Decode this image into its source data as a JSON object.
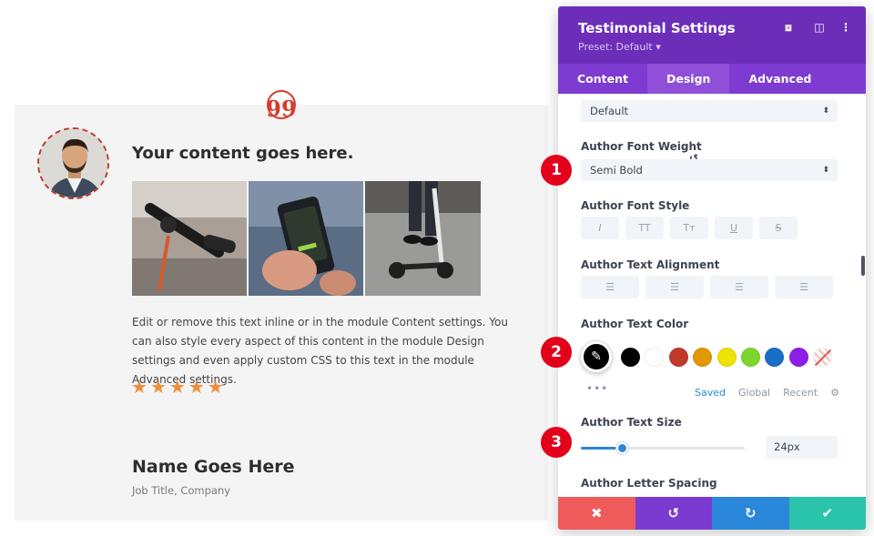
{
  "module": {
    "quote_glyph": "99",
    "content_title": "Your content goes here.",
    "body_text": "Edit or remove this text inline or in the module Content settings. You can also style every aspect of this content in the module Design settings and even apply custom CSS to this text in the module Advanced settings.",
    "rating": 5,
    "star_glyph": "★",
    "author_name": "Name Goes Here",
    "author_meta": "Job Title, Company"
  },
  "panel": {
    "title": "Testimonial Settings",
    "preset": "Preset: Default ▾",
    "tabs": [
      "Content",
      "Design",
      "Advanced"
    ],
    "active_tab": "Design",
    "font_select_value": "Default",
    "weight_label": "Author Font Weight",
    "weight_value": "Semi Bold",
    "style_label": "Author Font Style",
    "style_buttons": [
      "I",
      "TT",
      "Tт",
      "U",
      "S"
    ],
    "align_label": "Author Text Alignment",
    "color_label": "Author Text Color",
    "swatch_colors": [
      "#000000",
      "#ffffff",
      "#c0392b",
      "#e09900",
      "#ede200",
      "#7cd62d",
      "#1a6fc4",
      "#8c1ee5"
    ],
    "color_tabs": [
      "Saved",
      "Global",
      "Recent"
    ],
    "more_dots": "•••",
    "size_label": "Author Text Size",
    "size_value": "24px",
    "size_fraction": 0.25,
    "spacing_label": "Author Letter Spacing"
  },
  "markers": [
    "1",
    "2",
    "3"
  ],
  "colors": {
    "header": "#6c2eb9",
    "tabs": "#7d3bd1",
    "accent": "#2b87da",
    "cancel": "#ef5a5b",
    "undo": "#7c3bd0",
    "redo": "#2b87da",
    "save": "#29c4a9"
  }
}
